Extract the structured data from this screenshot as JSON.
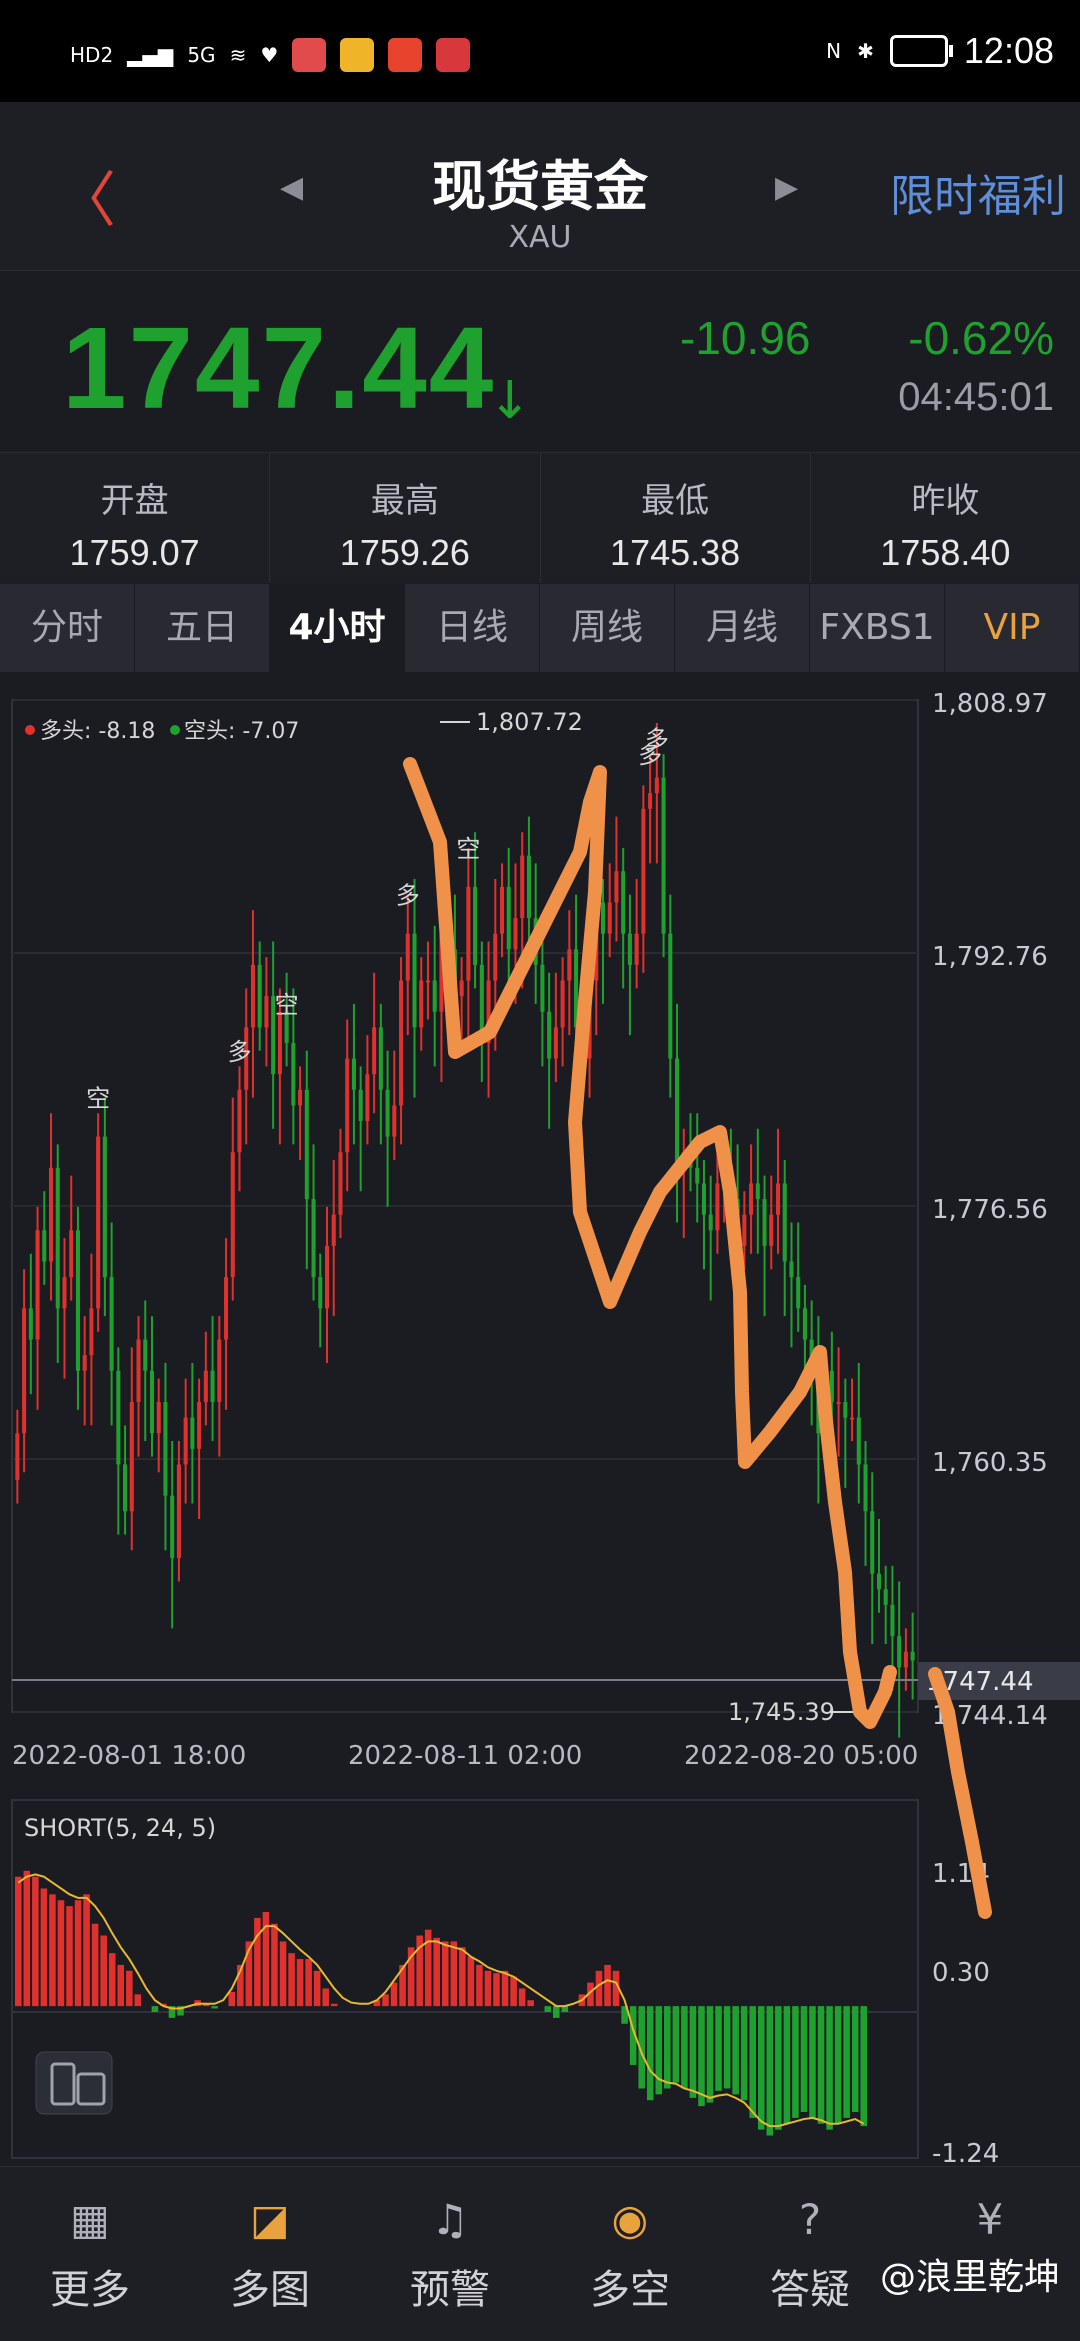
{
  "status_bar": {
    "time": "12:08",
    "hd": "HD2",
    "network": "5G"
  },
  "header": {
    "title": "现货黄金",
    "subtitle": "XAU",
    "promo": "限时福利"
  },
  "quote": {
    "price": "1747.44",
    "change": "-10.96",
    "change_pct": "-0.62%",
    "time": "04:45:01"
  },
  "stats": [
    {
      "label": "开盘",
      "value": "1759.07"
    },
    {
      "label": "最高",
      "value": "1759.26"
    },
    {
      "label": "最低",
      "value": "1745.38"
    },
    {
      "label": "昨收",
      "value": "1758.40"
    }
  ],
  "tabs": [
    "分时",
    "五日",
    "4小时",
    "日线",
    "周线",
    "月线",
    "FXBS1",
    "VIP"
  ],
  "active_tab": "4小时",
  "colors": {
    "up": "#e0312e",
    "down": "#1fa12f",
    "accent": "#5e8fd8",
    "vip": "#e8a33d",
    "annotation": "#f0914a"
  },
  "chart_data": {
    "type": "candlestick",
    "legend": {
      "long_label": "多头: -8.18",
      "short_label": "空头: -7.07"
    },
    "y_ticks": [
      "1,808.97",
      "1,792.76",
      "1,776.56",
      "1,760.35",
      "1,744.14"
    ],
    "y_tick_values": [
      1808.97,
      1792.76,
      1776.56,
      1760.35,
      1744.14
    ],
    "x_labels": [
      "2022-08-01 18:00",
      "2022-08-11 02:00",
      "2022-08-20 05:00"
    ],
    "max_label": "1,807.72",
    "min_label": "1,745.39",
    "current_price_label": "1747.44",
    "markers": [
      {
        "text": "空",
        "index": 12
      },
      {
        "text": "多",
        "index": 33
      },
      {
        "text": "空",
        "index": 40
      },
      {
        "text": "多",
        "index": 58
      },
      {
        "text": "空",
        "index": 67
      },
      {
        "text": "多",
        "index": 94
      },
      {
        "text": "多",
        "index": 95
      }
    ],
    "closes": [
      1762,
      1770,
      1768,
      1775,
      1773,
      1779,
      1770,
      1772,
      1775,
      1766,
      1767,
      1770,
      1781,
      1772,
      1766,
      1760,
      1757,
      1764,
      1768,
      1766,
      1762,
      1764,
      1758,
      1754,
      1760,
      1763,
      1761,
      1764,
      1766,
      1764,
      1768,
      1772,
      1780,
      1784,
      1788,
      1792,
      1788,
      1790,
      1785,
      1789,
      1787,
      1783,
      1784,
      1777,
      1772,
      1770,
      1774,
      1776,
      1780,
      1786,
      1784,
      1782,
      1785,
      1788,
      1784,
      1781,
      1783,
      1791,
      1794,
      1788,
      1791,
      1791,
      1789,
      1794,
      1793,
      1790,
      1791,
      1797,
      1792,
      1787,
      1791,
      1794,
      1797,
      1793,
      1795,
      1799,
      1795,
      1792,
      1789,
      1786,
      1788,
      1791,
      1793,
      1788,
      1786,
      1791,
      1796,
      1794,
      1796,
      1798,
      1794,
      1792,
      1794,
      1802,
      1803,
      1804,
      1794,
      1786,
      1779,
      1780,
      1779,
      1778,
      1776,
      1775,
      1778,
      1779,
      1777,
      1774,
      1776,
      1778,
      1777,
      1774,
      1776,
      1778,
      1773,
      1772,
      1770,
      1768,
      1766,
      1762,
      1766,
      1764,
      1764,
      1763,
      1763,
      1760,
      1757,
      1753,
      1752,
      1751,
      1749,
      1747,
      1748,
      1747.44
    ],
    "indicator": {
      "label": "SHORT(5, 24, 5)",
      "y_ticks": [
        "1.14",
        "0.30",
        "-1.24"
      ],
      "y_tick_values": [
        1.14,
        0.3,
        -1.24
      ],
      "bars": [
        1.1,
        1.15,
        1.1,
        1.0,
        0.95,
        0.9,
        0.85,
        0.9,
        0.95,
        0.7,
        0.6,
        0.45,
        0.35,
        0.3,
        0.1,
        0.0,
        -0.05,
        0.02,
        -0.1,
        -0.08,
        0.0,
        0.05,
        0.02,
        -0.02,
        0.0,
        0.12,
        0.35,
        0.55,
        0.75,
        0.8,
        0.7,
        0.55,
        0.45,
        0.4,
        0.4,
        0.3,
        0.15,
        0.02,
        0.0,
        0.0,
        0.0,
        0.0,
        0.05,
        0.1,
        0.2,
        0.35,
        0.5,
        0.6,
        0.65,
        0.58,
        0.55,
        0.55,
        0.5,
        0.42,
        0.35,
        0.3,
        0.28,
        0.3,
        0.25,
        0.15,
        0.05,
        0.0,
        -0.05,
        -0.1,
        -0.05,
        0.0,
        0.1,
        0.2,
        0.3,
        0.35,
        0.3,
        -0.15,
        -0.5,
        -0.7,
        -0.8,
        -0.75,
        -0.7,
        -0.65,
        -0.7,
        -0.78,
        -0.85,
        -0.82,
        -0.72,
        -0.7,
        -0.75,
        -0.8,
        -0.95,
        -1.05,
        -1.1,
        -1.05,
        -1.0,
        -0.95,
        -0.9,
        -0.95,
        -1.0,
        -1.05,
        -1.0,
        -0.95,
        -0.9,
        -1.02
      ],
      "signal": [
        1.05,
        1.1,
        1.12,
        1.1,
        1.05,
        1.0,
        0.95,
        0.92,
        0.92,
        0.85,
        0.75,
        0.62,
        0.5,
        0.4,
        0.28,
        0.15,
        0.05,
        0.0,
        -0.02,
        -0.02,
        0.0,
        0.02,
        0.02,
        0.02,
        0.05,
        0.15,
        0.3,
        0.48,
        0.6,
        0.68,
        0.68,
        0.62,
        0.55,
        0.48,
        0.42,
        0.35,
        0.25,
        0.15,
        0.07,
        0.03,
        0.02,
        0.02,
        0.05,
        0.12,
        0.22,
        0.32,
        0.42,
        0.5,
        0.55,
        0.55,
        0.52,
        0.5,
        0.48,
        0.42,
        0.38,
        0.33,
        0.3,
        0.28,
        0.25,
        0.2,
        0.15,
        0.1,
        0.05,
        0.0,
        0.0,
        0.02,
        0.05,
        0.12,
        0.18,
        0.22,
        0.2,
        0.05,
        -0.2,
        -0.4,
        -0.55,
        -0.62,
        -0.65,
        -0.66,
        -0.7,
        -0.72,
        -0.75,
        -0.78,
        -0.76,
        -0.75,
        -0.78,
        -0.82,
        -0.9,
        -0.98,
        -1.02,
        -1.02,
        -1.0,
        -0.98,
        -0.96,
        -0.95,
        -0.97,
        -1.0,
        -1.0,
        -0.98,
        -0.96,
        -1.0
      ]
    }
  },
  "bottom_nav": [
    {
      "label": "更多",
      "icon": "grid-icon"
    },
    {
      "label": "多图",
      "icon": "multi-chart-icon"
    },
    {
      "label": "预警",
      "icon": "bell-icon"
    },
    {
      "label": "多空",
      "icon": "long-short-icon"
    },
    {
      "label": "答疑",
      "icon": "question-cap-icon"
    },
    {
      "label": "",
      "icon": "yuan-bag-icon"
    }
  ],
  "watermark": "@浪里乾坤"
}
